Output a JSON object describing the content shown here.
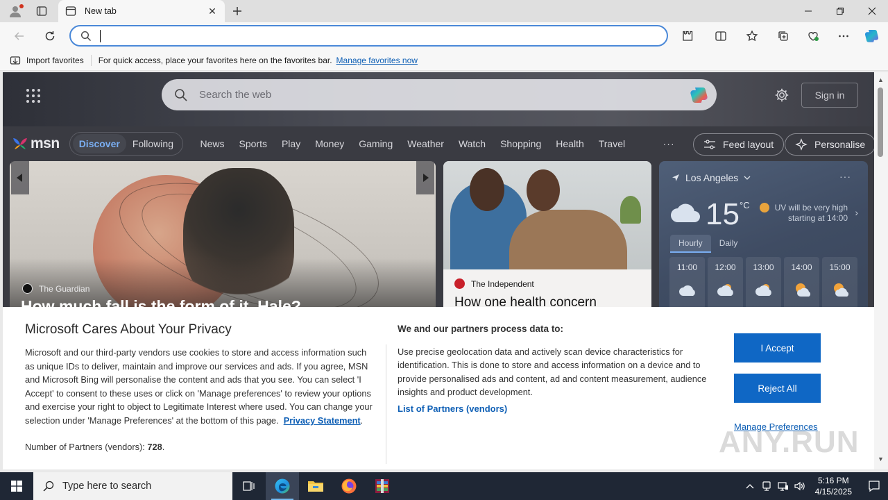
{
  "browser": {
    "tab_title": "New tab",
    "address_value": "",
    "favbar": {
      "import_label": "Import favorites",
      "message": "For quick access, place your favorites here on the favorites bar.",
      "manage_link": "Manage favorites now"
    }
  },
  "msn": {
    "search_placeholder": "Search the web",
    "signin_label": "Sign in",
    "logo_text": "msn",
    "segments": [
      "Discover",
      "Following"
    ],
    "active_segment": "Discover",
    "nav_items": [
      "News",
      "Sports",
      "Play",
      "Money",
      "Gaming",
      "Weather",
      "Watch",
      "Shopping",
      "Health",
      "Travel"
    ],
    "more_label": "···",
    "feed_layout_label": "Feed layout",
    "personalise_label": "Personalise",
    "main_card": {
      "source": "The Guardian",
      "headline": "How much fall is the form of it, Hale?"
    },
    "news_card": {
      "source": "The Independent",
      "headline": "How one health concern"
    },
    "weather": {
      "location": "Los Angeles",
      "temperature": "15",
      "unit": "°C",
      "uv_text": "UV will be very high starting at 14:00",
      "tabs": [
        "Hourly",
        "Daily"
      ],
      "hours": [
        "11:00",
        "12:00",
        "13:00",
        "14:00",
        "15:00"
      ]
    }
  },
  "privacy": {
    "title": "Microsoft Cares About Your Privacy",
    "body": "Microsoft and our third-party vendors use cookies to store and access information such as unique IDs to deliver, maintain and improve our services and ads. If you agree, MSN and Microsoft Bing will personalise the content and ads that you see. You can select 'I Accept' to consent to these uses or click on 'Manage preferences' to review your options and exercise your right to object to Legitimate Interest where used.  You can change your selection under 'Manage Preferences' at the bottom of this page.",
    "statement_link": "Privacy Statement",
    "partners_count_label": "Number of Partners (vendors):",
    "partners_count": "728",
    "purpose_heading": "We and our partners process data to:",
    "purpose_text": "Use precise geolocation data and actively scan device characteristics for identification. This is done to store and access information on a device and to provide personalised ads and content, ad and content measurement, audience insights and product development.",
    "partners_link": "List of Partners (vendors)",
    "accept_label": "I Accept",
    "reject_label": "Reject All",
    "manage_label": "Manage Preferences"
  },
  "watermark": "ANY.RUN",
  "taskbar": {
    "search_placeholder": "Type here to search",
    "time": "5:16 PM",
    "date": "4/15/2025"
  }
}
